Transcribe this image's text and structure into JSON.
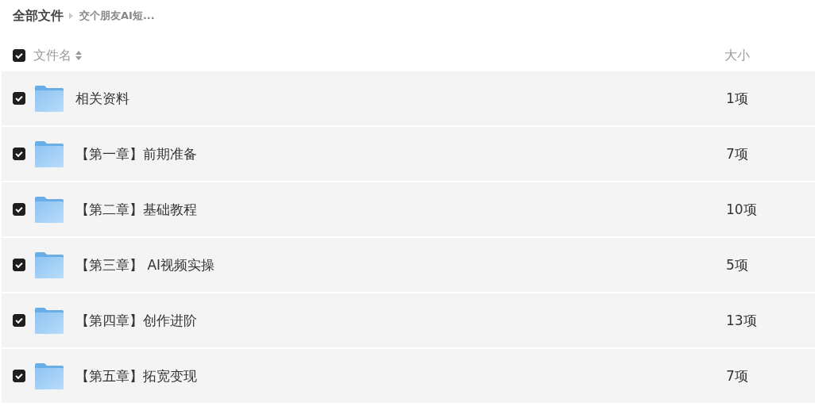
{
  "breadcrumb": [
    {
      "label": "全部文件"
    },
    {
      "label": "交个朋友AI短..."
    }
  ],
  "header": {
    "checked": true,
    "name_column": "文件名",
    "size_column": "大小"
  },
  "rows": [
    {
      "name": "相关资料",
      "size": "1项",
      "checked": true
    },
    {
      "name": "【第一章】前期准备",
      "size": "7项",
      "checked": true
    },
    {
      "name": "【第二章】基础教程",
      "size": "10项",
      "checked": true
    },
    {
      "name": "【第三章】 AI视频实操",
      "size": "5项",
      "checked": true
    },
    {
      "name": "【第四章】创作进阶",
      "size": "13项",
      "checked": true
    },
    {
      "name": "【第五章】拓宽变现",
      "size": "7项",
      "checked": true
    }
  ]
}
